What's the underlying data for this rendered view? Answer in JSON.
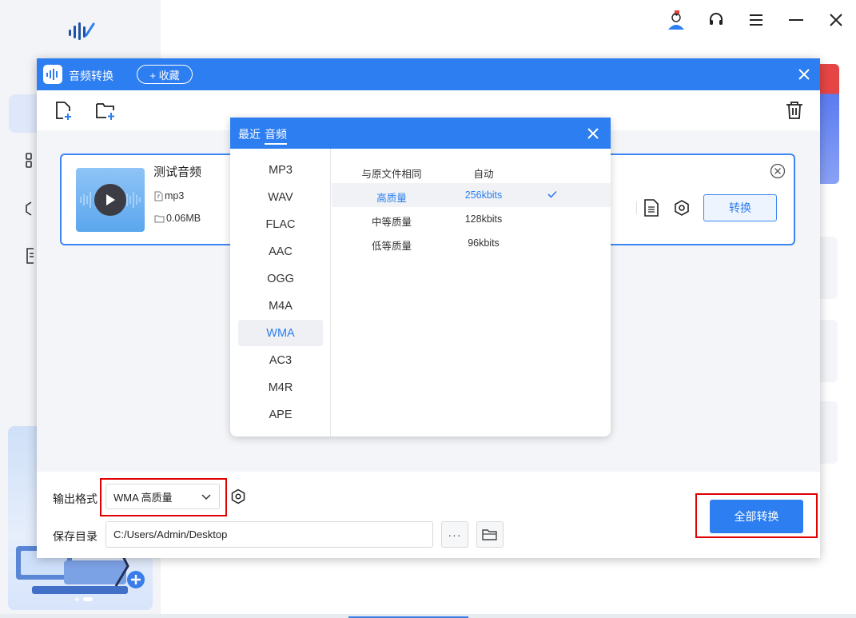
{
  "app": {
    "top_icons": [
      "user-avatar-icon",
      "headset-icon",
      "menu-icon",
      "minimize-icon",
      "close-icon"
    ],
    "sidebar_icons": [
      "audio-wave-icon",
      "apps-grid-icon",
      "cube-icon",
      "document-icon"
    ]
  },
  "dialog": {
    "title": "音频转换",
    "favorite_label": "+ 收藏",
    "toolbar_icons": [
      "add-file-icon",
      "add-folder-icon",
      "trash-icon"
    ]
  },
  "file": {
    "name": "测试音频",
    "format": "mp3",
    "size": "0.06MB",
    "bitrate_tail": ")",
    "convert_label": "转换"
  },
  "popup": {
    "tabs": [
      "最近",
      "音频"
    ],
    "active_tab": "音频",
    "formats": [
      "MP3",
      "WAV",
      "FLAC",
      "AAC",
      "OGG",
      "M4A",
      "WMA",
      "AC3",
      "M4R",
      "APE"
    ],
    "selected_format": "WMA",
    "qualities": [
      {
        "name": "与原文件相同",
        "bitrate": "自动",
        "selected": false
      },
      {
        "name": "高质量",
        "bitrate": "256kbits",
        "selected": true
      },
      {
        "name": "中等质量",
        "bitrate": "128kbits",
        "selected": false
      },
      {
        "name": "低等质量",
        "bitrate": "96kbits",
        "selected": false
      }
    ]
  },
  "bottom": {
    "output_label": "输出格式",
    "output_value": "WMA 高质量",
    "save_label": "保存目录",
    "save_path": "C:/Users/Admin/Desktop",
    "more_label": "···",
    "convert_all_label": "全部转换"
  },
  "colors": {
    "accent": "#2d7ef0",
    "highlight": "#e00000",
    "work_bg": "#f3f5f8"
  }
}
